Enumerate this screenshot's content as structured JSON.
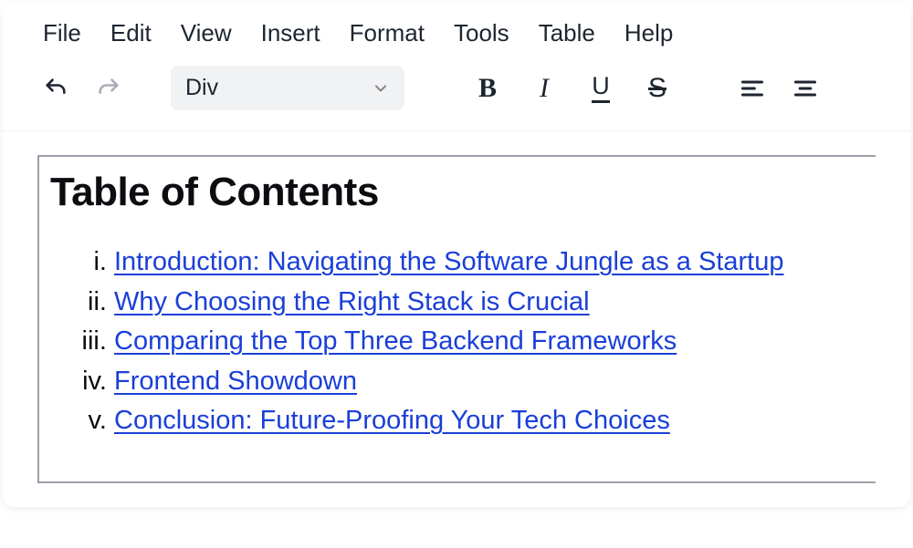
{
  "menubar": {
    "items": [
      "File",
      "Edit",
      "View",
      "Insert",
      "Format",
      "Tools",
      "Table",
      "Help"
    ]
  },
  "toolbar": {
    "block_select": "Div"
  },
  "content": {
    "toc_title": "Table of Contents",
    "toc_items": [
      "Introduction: Navigating the Software Jungle as a Startup",
      "Why Choosing the Right Stack is Crucial",
      "Comparing the Top Three Backend Frameworks",
      "Frontend Showdown",
      "Conclusion: Future-Proofing Your Tech Choices"
    ]
  }
}
